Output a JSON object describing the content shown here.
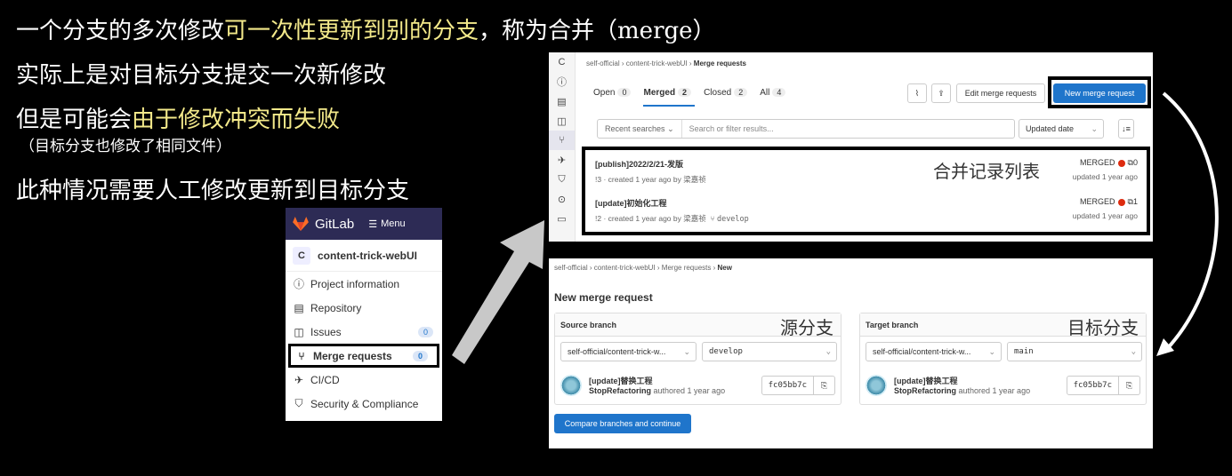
{
  "slide": {
    "line1_a": "一个分支的多次修改",
    "line1_b": "可一次性更新到别的分支",
    "line1_c": "，称为合并（merge）",
    "line2": "实际上是对目标分支提交一次新修改",
    "line3_a": "但是可能会",
    "line3_b": "由于修改冲突而失败",
    "line3_sub": "（目标分支也修改了相同文件）",
    "line4": "此种情况需要人工修改更新到目标分支"
  },
  "sidebar": {
    "brand": "GitLab",
    "menu_label": "Menu",
    "project_initial": "C",
    "project_name": "content-trick-webUI",
    "items": [
      {
        "label": "Project information",
        "icon": "info-icon"
      },
      {
        "label": "Repository",
        "icon": "repository-icon"
      },
      {
        "label": "Issues",
        "icon": "issues-icon",
        "badge": "0"
      },
      {
        "label": "Merge requests",
        "icon": "merge-request-icon",
        "badge": "0",
        "active": true
      },
      {
        "label": "CI/CD",
        "icon": "rocket-icon"
      },
      {
        "label": "Security & Compliance",
        "icon": "shield-icon"
      }
    ]
  },
  "mr_list": {
    "left_initial": "C",
    "breadcrumb": [
      "self-official",
      "content-trick-webUI",
      "Merge requests"
    ],
    "tabs": [
      {
        "label": "Open",
        "count": "0"
      },
      {
        "label": "Merged",
        "count": "2"
      },
      {
        "label": "Closed",
        "count": "2"
      },
      {
        "label": "All",
        "count": "4"
      }
    ],
    "edit_button": "Edit merge requests",
    "new_button": "New merge request",
    "recent_searches": "Recent searches",
    "filter_placeholder": "Search or filter results...",
    "sort_label": "Updated date",
    "annotation": "合并记录列表",
    "rows": [
      {
        "title": "[publish]2022/2/21-发版",
        "meta": "!3 · created 1 year ago by 梁嘉祯",
        "branch": "",
        "status": "MERGED",
        "comments": "0",
        "updated": "updated 1 year ago"
      },
      {
        "title": "[update]初始化工程",
        "meta": "!2 · created 1 year ago by 梁嘉祯",
        "branch": "develop",
        "status": "MERGED",
        "comments": "1",
        "updated": "updated 1 year ago"
      }
    ]
  },
  "new_mr": {
    "breadcrumb": [
      "self-official",
      "content-trick-webUI",
      "Merge requests",
      "New"
    ],
    "title": "New merge request",
    "source": {
      "heading": "Source branch",
      "annotation": "源分支",
      "project": "self-official/content-trick-w...",
      "branch": "develop",
      "commit_title": "[update]替换工程",
      "commit_author": "StopRefactoring",
      "commit_time": " authored 1 year ago",
      "sha": "fc05bb7c"
    },
    "target": {
      "heading": "Target branch",
      "annotation": "目标分支",
      "project": "self-official/content-trick-w...",
      "branch": "main",
      "commit_title": "[update]替换工程",
      "commit_author": "StopRefactoring",
      "commit_time": " authored 1 year ago",
      "sha": "fc05bb7c"
    },
    "compare_button": "Compare branches and continue"
  },
  "colors": {
    "accent": "#1f75cb",
    "highlight": "#f3e98a",
    "gitlab_nav": "#2d2b55",
    "merged_dot": "#dd2b0e"
  }
}
